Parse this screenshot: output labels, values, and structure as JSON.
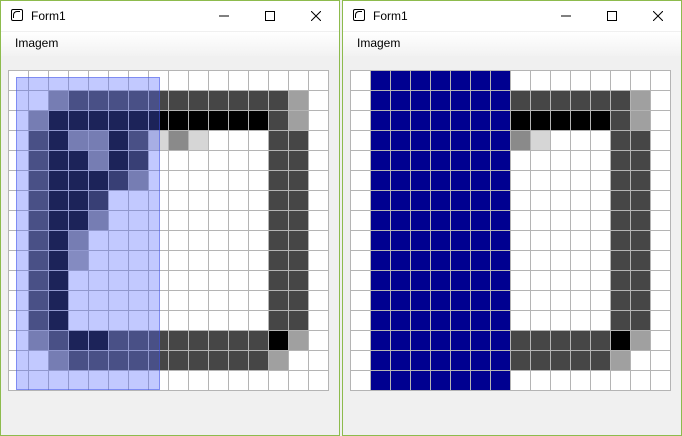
{
  "windows": [
    {
      "title": "Form1",
      "menu": [
        "Imagem"
      ],
      "show_selection": true,
      "selection_columns": [
        0,
        7
      ],
      "selection_fill": "#0000ff"
    },
    {
      "title": "Form1",
      "menu": [
        "Imagem"
      ],
      "show_selection": false,
      "fill_columns": [
        1,
        8
      ],
      "fill_color": "#000090"
    }
  ],
  "image": {
    "columns": 16,
    "rows": 16,
    "palette": {
      "W": "#ffffff",
      "L": "#d6d6d6",
      "M": "#8a8a8a",
      "G": "#464646",
      "D": "#2c2c2c",
      "K": "#000000",
      "S": "#a0a0a0"
    },
    "rows_data": [
      "WWWWWWWWWWWWWWWW",
      "WWMGGGGGGGGGGGSW",
      "WMKKKKKKKKKKKGSW",
      "WGKMMKGLMLWWWGGW",
      "WGKKMKDWWWWWWGGW",
      "WGKKKDMWWWWWWGGW",
      "WGKKDWWWWWWWWGGW",
      "WGKKMWWWWWWWWGGW",
      "WGKMWWWWWWWWWGGW",
      "WGKSWWWWWWWWWGGW",
      "WGKWWWWWWWWWWGGW",
      "WGKWWWWWWWWWWGGW",
      "WGKWWWWWWWWWWGGW",
      "WMGKKGGGGGGGGKSW",
      "WWMGGGGGGGGGGSWW",
      "WWWWWWWWWWWWWWWW"
    ]
  }
}
